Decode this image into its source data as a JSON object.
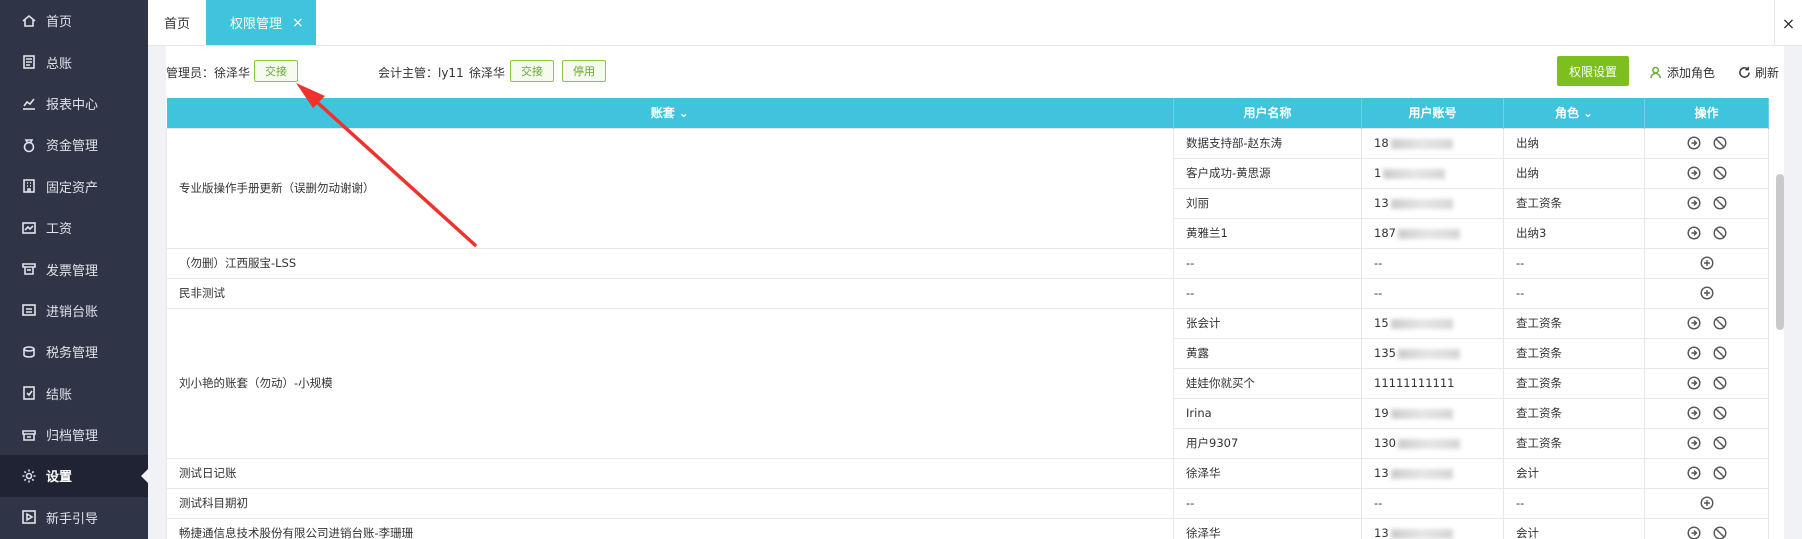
{
  "sidebar": {
    "items": [
      {
        "label": "首页",
        "icon": "home-icon"
      },
      {
        "label": "总账",
        "icon": "ledger-icon"
      },
      {
        "label": "报表中心",
        "icon": "chart-icon"
      },
      {
        "label": "资金管理",
        "icon": "money-bag-icon"
      },
      {
        "label": "固定资产",
        "icon": "building-icon"
      },
      {
        "label": "工资",
        "icon": "salary-icon"
      },
      {
        "label": "发票管理",
        "icon": "invoice-icon"
      },
      {
        "label": "进销台账",
        "icon": "inventory-icon"
      },
      {
        "label": "税务管理",
        "icon": "tax-icon"
      },
      {
        "label": "结账",
        "icon": "checkout-icon"
      },
      {
        "label": "归档管理",
        "icon": "archive-icon"
      },
      {
        "label": "设置",
        "icon": "gear-icon",
        "active": true
      },
      {
        "label": "新手引导",
        "icon": "guide-icon"
      }
    ]
  },
  "tabs": {
    "home": "首页",
    "active": "权限管理",
    "close": "×",
    "close_all": "×"
  },
  "toolbar": {
    "admin_label": "管理员：徐泽华",
    "handover": "交接",
    "supervisor_label": "会计主管：ly11",
    "supervisor_name": "徐泽华",
    "handover2": "交接",
    "disable": "停用",
    "permission_settings": "权限设置",
    "add_role": "添加角色",
    "refresh": "刷新"
  },
  "table": {
    "headers": {
      "account": "账套",
      "user_name": "用户名称",
      "user_account": "用户账号",
      "role": "角色",
      "ops": "操作"
    },
    "groups": [
      {
        "account": "专业版操作手册更新（误删勿动谢谢）",
        "rows": [
          {
            "name": "数据支持部-赵东涛",
            "acct": "18",
            "role": "出纳"
          },
          {
            "name": "客户成功-黄思源",
            "acct": "1",
            "role": "出纳"
          },
          {
            "name": "刘丽",
            "acct": "13",
            "role": "查工资条"
          },
          {
            "name": "黄雅兰1",
            "acct": "187",
            "role": "出纳3"
          }
        ]
      },
      {
        "account": "（勿删）江西服宝-LSS",
        "rows": [
          {
            "name": "--",
            "acct": "--",
            "role": "--",
            "empty": true
          }
        ]
      },
      {
        "account": "民非测试",
        "rows": [
          {
            "name": "--",
            "acct": "--",
            "role": "--",
            "empty": true
          }
        ]
      },
      {
        "account": "刘小艳的账套（勿动）-小规模",
        "rows": [
          {
            "name": "张会计",
            "acct": "15",
            "role": "查工资条"
          },
          {
            "name": "黄露",
            "acct": "135",
            "role": "查工资条"
          },
          {
            "name": "娃娃你就买个",
            "acct": "11111111111",
            "role": "查工资条",
            "clear": true
          },
          {
            "name": "Irina",
            "acct": "19",
            "role": "查工资条"
          },
          {
            "name": "用户9307",
            "acct": "130",
            "role": "查工资条"
          }
        ]
      },
      {
        "account": "测试日记账",
        "rows": [
          {
            "name": "徐泽华",
            "acct": "13",
            "role": "会计"
          }
        ]
      },
      {
        "account": "测试科目期初",
        "rows": [
          {
            "name": "--",
            "acct": "--",
            "role": "--",
            "empty": true
          }
        ]
      },
      {
        "account": "畅捷通信息技术股份有限公司进销台账-李珊珊",
        "rows": [
          {
            "name": "徐泽华",
            "acct": "13",
            "role": "会计"
          }
        ]
      }
    ]
  },
  "colors": {
    "accent": "#40c3dc",
    "green": "#7dbf1f",
    "sidebar": "#2f3446",
    "arrow": "#f0322e"
  }
}
